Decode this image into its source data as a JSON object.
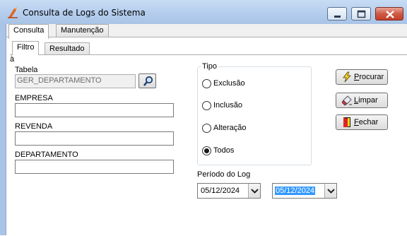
{
  "window": {
    "title": "Consulta de Logs do Sistema",
    "controls": {
      "minimize": "minimize-icon",
      "maximize": "maximize-icon",
      "close": "close-icon"
    }
  },
  "tabs_outer": [
    {
      "label": "Consulta",
      "active": true
    },
    {
      "label": "Manutenção",
      "active": false
    }
  ],
  "tabs_inner": [
    {
      "label": "Filtro",
      "active": true
    },
    {
      "label": "Resultado",
      "active": false
    }
  ],
  "form": {
    "tabela": {
      "label": "Tabela",
      "value": "GER_DEPARTAMENTO"
    },
    "empresa": {
      "label": "EMPRESA",
      "value": ""
    },
    "revenda": {
      "label": "REVENDA",
      "value": ""
    },
    "departamento": {
      "label": "DEPARTAMENTO",
      "value": ""
    }
  },
  "tipo": {
    "title": "Tipo",
    "options": [
      {
        "label": "Exclusão",
        "checked": false
      },
      {
        "label": "Inclusão",
        "checked": false
      },
      {
        "label": "Alteração",
        "checked": false
      },
      {
        "label": "Todos",
        "checked": true
      }
    ]
  },
  "buttons": {
    "procurar": {
      "accel": "P",
      "rest": "rocurar",
      "icon": "lightning-icon"
    },
    "limpar": {
      "accel": "L",
      "rest": "impar",
      "icon": "eraser-icon"
    },
    "fechar": {
      "accel": "F",
      "rest": "echar",
      "icon": "door-icon"
    }
  },
  "periodo": {
    "label": "Período do Log",
    "from": "05/12/2024",
    "separator": "à",
    "to": "05/12/2024"
  },
  "colors": {
    "title_bar": "#b3cced",
    "selection": "#3399ff",
    "close_button": "#c33f2a"
  }
}
